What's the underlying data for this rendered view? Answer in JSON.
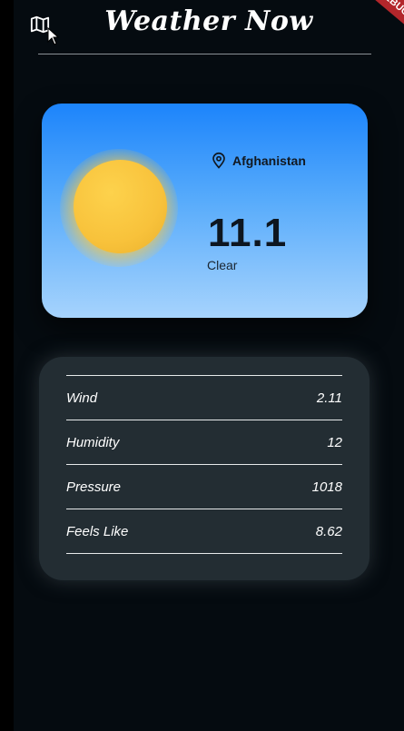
{
  "app": {
    "title": "Weather Now",
    "debug_ribbon": "DEBUG"
  },
  "weather": {
    "location": "Afghanistan",
    "temperature": "11.1",
    "condition": "Clear"
  },
  "details": [
    {
      "label": "Wind",
      "value": "2.11"
    },
    {
      "label": "Humidity",
      "value": "12"
    },
    {
      "label": "Pressure",
      "value": "1018"
    },
    {
      "label": "Feels Like",
      "value": "8.62"
    }
  ],
  "icons": {
    "map": "map-icon",
    "location": "location-pin-icon",
    "sun": "sun-icon"
  },
  "colors": {
    "background": "#050b10",
    "card_top": "#1c84fb",
    "card_bottom": "#a6d3fd",
    "sun": "#f8c23b",
    "details_card": "#232d33"
  }
}
